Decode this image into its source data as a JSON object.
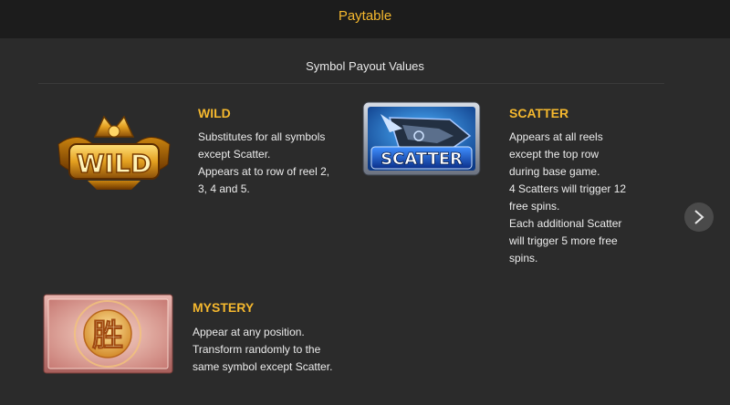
{
  "header": {
    "title": "Paytable"
  },
  "section": {
    "title": "Symbol Payout Values"
  },
  "symbols": [
    {
      "name": "WILD",
      "icon_text": "WILD",
      "lines": [
        "Substitutes for all symbols",
        "except Scatter.",
        "Appears at to row of reel 2,",
        "3, 4 and 5."
      ]
    },
    {
      "name": "SCATTER",
      "icon_text": "SCATTER",
      "lines": [
        "Appears at all reels",
        "except the top row",
        "during base game.",
        "4 Scatters will trigger 12",
        "free spins.",
        "Each additional Scatter",
        "will trigger 5 more free",
        "spins."
      ]
    },
    {
      "name": "MYSTERY",
      "icon_text": "胜",
      "lines": [
        "Appear at any position.",
        "Transform randomly to the",
        "same symbol except Scatter."
      ]
    }
  ],
  "nav": {
    "next_icon": "chevron-right-icon"
  },
  "colors": {
    "accent": "#f5b82e",
    "background": "#2b2b2b",
    "header": "#1c1c1c",
    "text": "#ececec"
  }
}
